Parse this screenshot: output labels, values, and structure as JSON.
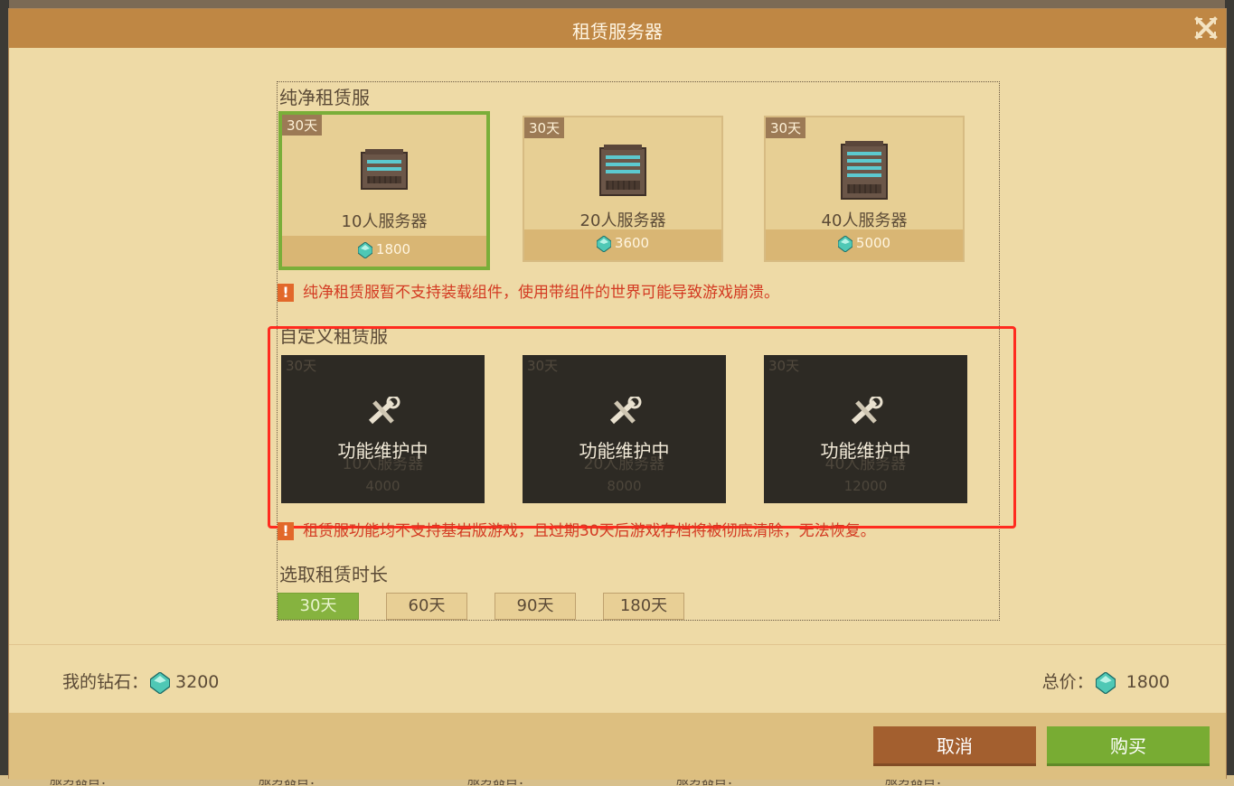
{
  "dialog": {
    "title": "租赁服务器"
  },
  "pure": {
    "section_title": "纯净租赁服",
    "cards": [
      {
        "badge": "30天",
        "name": "10人服务器",
        "price": "1800",
        "selected": true
      },
      {
        "badge": "30天",
        "name": "20人服务器",
        "price": "3600",
        "selected": false
      },
      {
        "badge": "30天",
        "name": "40人服务器",
        "price": "5000",
        "selected": false
      }
    ],
    "warning": "纯净租赁服暂不支持装载组件，使用带组件的世界可能导致游戏崩溃。"
  },
  "custom": {
    "section_title": "自定义租赁服",
    "cards": [
      {
        "badge": "30天",
        "name": "10人服务器",
        "price": "4000",
        "status": "功能维护中"
      },
      {
        "badge": "30天",
        "name": "20人服务器",
        "price": "8000",
        "status": "功能维护中"
      },
      {
        "badge": "30天",
        "name": "40人服务器",
        "price": "12000",
        "status": "功能维护中"
      }
    ],
    "warning": "租赁服功能均不支持基岩版游戏，且过期30天后游戏存档将被彻底清除，无法恢复。"
  },
  "duration": {
    "label": "选取租赁时长",
    "options": [
      "30天",
      "60天",
      "90天",
      "180天"
    ],
    "selected_index": 0
  },
  "summary": {
    "my_diamond_label": "我的钻石：",
    "my_diamond_value": "3200",
    "total_label": "总价：",
    "total_value": "1800"
  },
  "buttons": {
    "cancel": "取消",
    "buy": "购买"
  },
  "background": {
    "footer_texts": [
      "服务器目：",
      "服务器目：",
      "服务器目：",
      "服务器目：",
      "服务器目："
    ]
  },
  "colors": {
    "title_bar": "#bf8744",
    "dialog_bg": "#eedaa6",
    "selected_green": "#7aae39",
    "warning_red": "#d33a22",
    "highlight_red": "#ff2b1f",
    "cancel_brown": "#a35f2f",
    "buy_green": "#78ac33"
  },
  "icons": [
    "close-icon",
    "server-icon",
    "diamond-icon",
    "maintenance-tools-icon",
    "warning-icon"
  ]
}
